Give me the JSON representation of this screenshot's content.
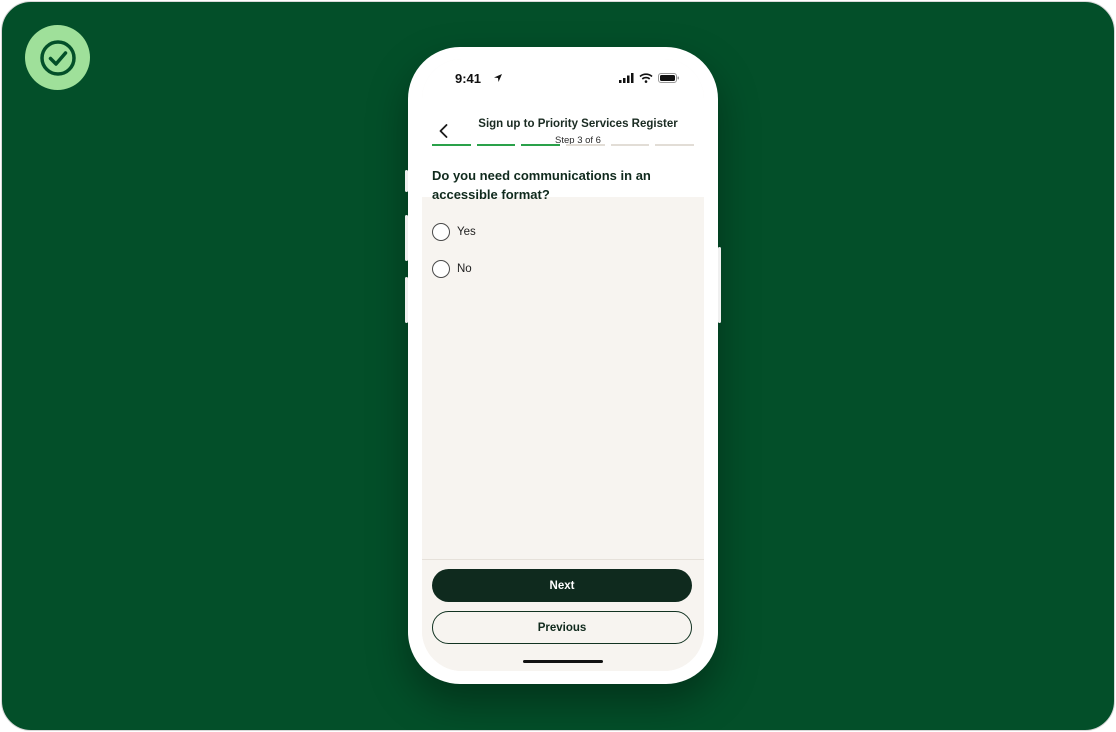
{
  "status_bar": {
    "time": "9:41"
  },
  "header": {
    "title": "Sign up to Priority Services Register",
    "step": "Step 3 of 6",
    "progress": {
      "completed": 3,
      "total": 6
    }
  },
  "question": {
    "text": "Do you need communications in an accessible format?",
    "options": [
      {
        "label": "Yes",
        "selected": false
      },
      {
        "label": "No",
        "selected": false
      }
    ]
  },
  "buttons": {
    "next": "Next",
    "previous": "Previous"
  },
  "colors": {
    "background": "#034f29",
    "accent": "#2aa14a",
    "badge": "#9fe09a",
    "primary_button": "#0f2a1e",
    "screen_bg": "#f7f4f0"
  },
  "icons": {
    "badge": "check-circle-icon",
    "back": "chevron-left-icon",
    "location": "location-arrow-icon",
    "signal": "signal-icon",
    "wifi": "wifi-icon",
    "battery": "battery-icon"
  }
}
